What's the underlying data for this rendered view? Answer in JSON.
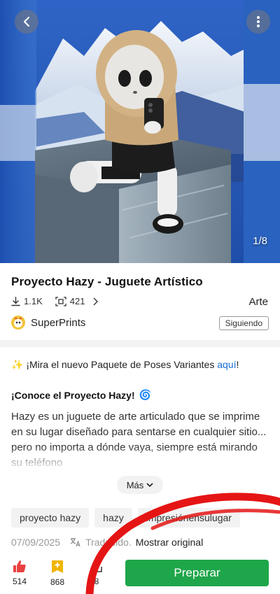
{
  "hero": {
    "photo_counter": "1/8"
  },
  "model": {
    "title": "Proyecto Hazy - Juguete Artístico",
    "downloads": "1.1K",
    "prints": "421",
    "category": "Arte"
  },
  "creator": {
    "name": "SuperPrints",
    "follow_label": "Siguiendo"
  },
  "description": {
    "promo_emoji": "✨",
    "promo_text": " ¡Mira el nuevo Paquete de Poses Variantes ",
    "promo_link": "aquí",
    "promo_end": "!",
    "heading": "¡Conoce el Proyecto Hazy!",
    "heading_emoji": "🌀",
    "body": "Hazy es un juguete de arte articulado que se imprime en su lugar diseñado para sentarse en cualquier sitio... pero no importa a dónde vaya, siempre está mirando su teléfono",
    "more_label": "Más"
  },
  "tags": [
    "proyecto hazy",
    "hazy",
    "impresiónensulugar"
  ],
  "meta": {
    "date": "07/09/2025",
    "translated": "Traducido.",
    "show_original": "Mostrar original"
  },
  "bottom_bar": {
    "likes": "514",
    "boosts": "868",
    "shares": "8",
    "primary_label": "Preparar"
  },
  "colors": {
    "accent_green": "#1fa64a",
    "link_blue": "#1a6fd6",
    "like_red": "#e8413f",
    "boost_yellow": "#f0b400",
    "annotation_red": "#e51515"
  }
}
